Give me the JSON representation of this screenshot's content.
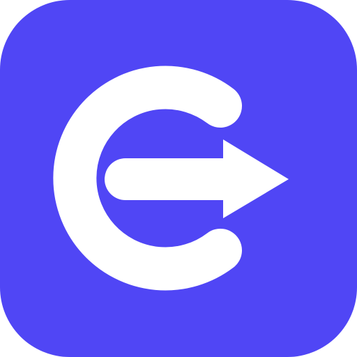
{
  "icon": {
    "name": "exit-arrow-app-icon",
    "background_color": "#5046F5",
    "glyph_color": "#FFFFFF"
  }
}
